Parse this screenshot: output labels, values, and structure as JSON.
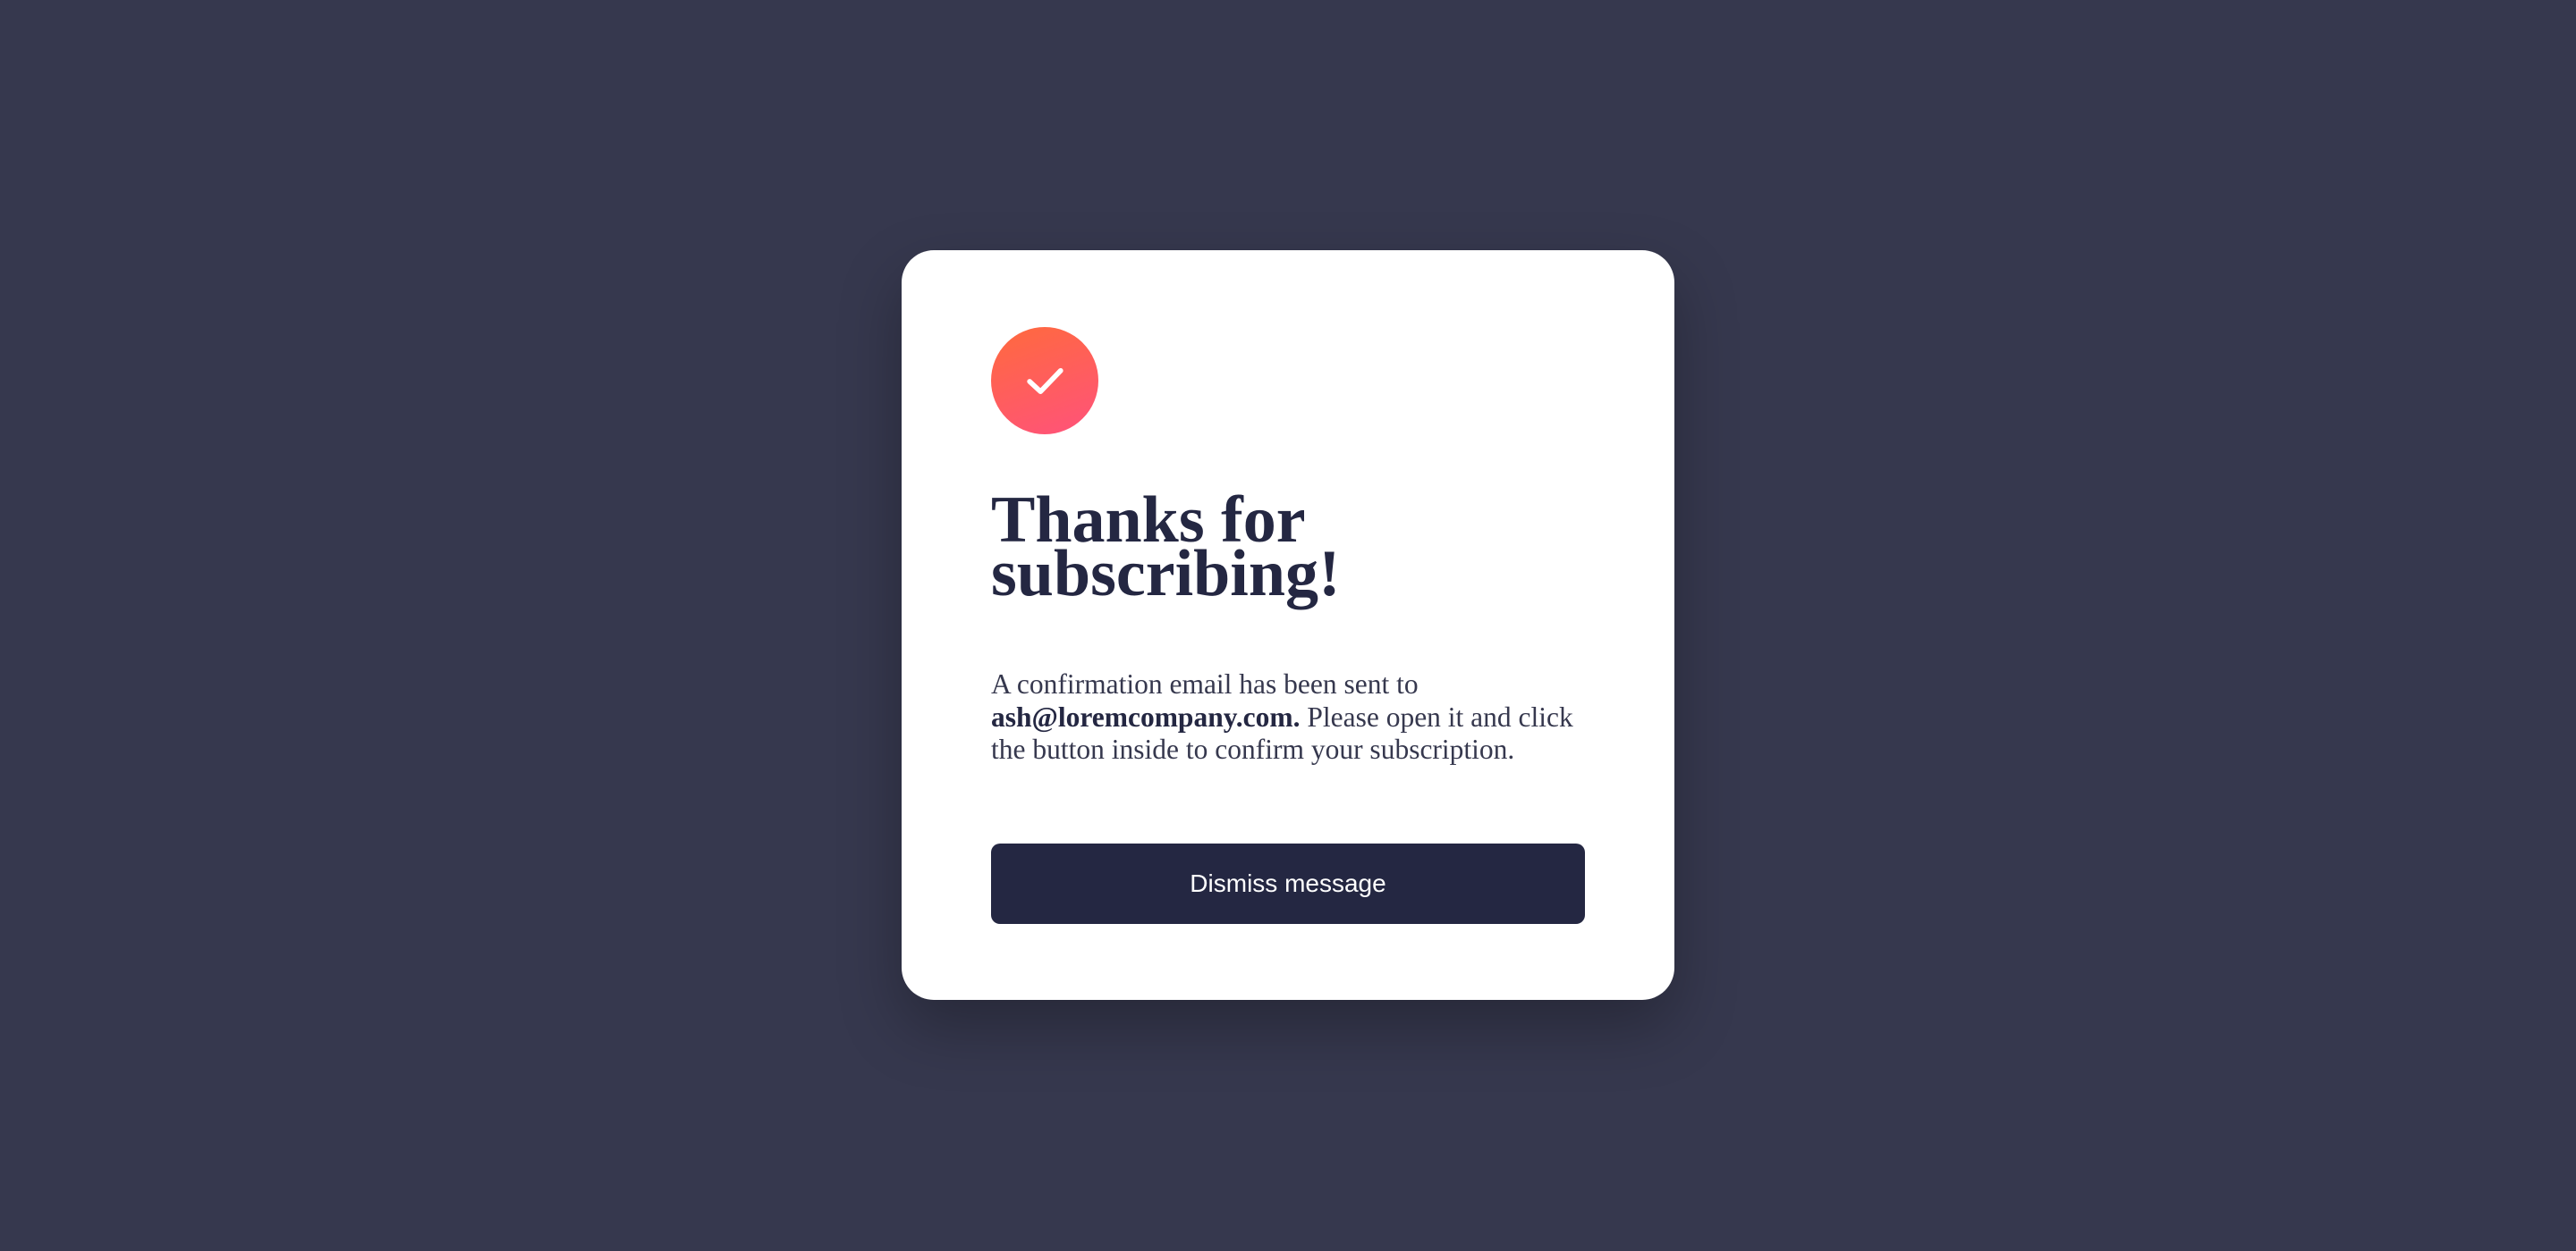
{
  "card": {
    "icon": "check-icon",
    "title": "Thanks for subscribing!",
    "message": {
      "prefix": "A confirmation email has been sent to ",
      "email": "ash@loremcompany.com.",
      "suffix": " Please open it and click the button inside to confirm your subscription."
    },
    "dismiss_label": "Dismiss message"
  },
  "colors": {
    "background": "#36384e",
    "card": "#ffffff",
    "heading": "#242742",
    "button": "#242742",
    "accent_start": "#ff6a3d",
    "accent_end": "#ff527b"
  }
}
